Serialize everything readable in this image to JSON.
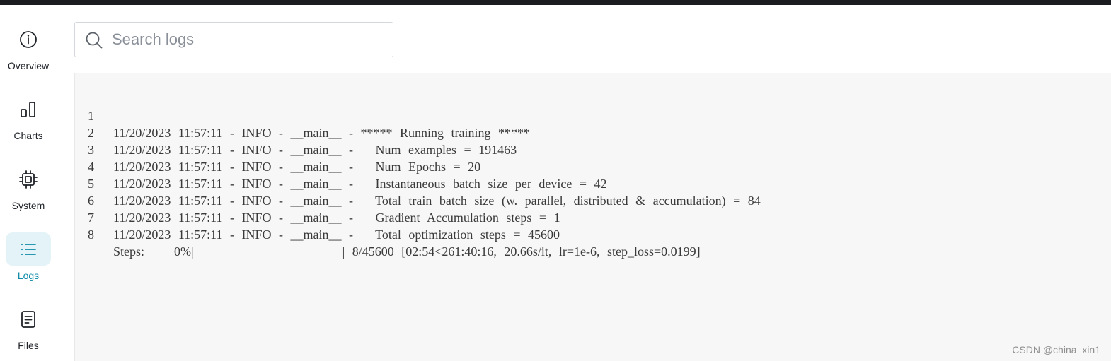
{
  "sidebar": {
    "items": [
      {
        "label": "Overview",
        "icon": "info-icon",
        "active": false
      },
      {
        "label": "Charts",
        "icon": "chart-icon",
        "active": false
      },
      {
        "label": "System",
        "icon": "chip-icon",
        "active": false
      },
      {
        "label": "Logs",
        "icon": "list-icon",
        "active": true
      },
      {
        "label": "Files",
        "icon": "file-icon",
        "active": false
      }
    ]
  },
  "search": {
    "placeholder": "Search logs",
    "value": ""
  },
  "logs": {
    "lines": [
      {
        "num": "1",
        "text": "11/20/2023 11:57:11 - INFO - __main__ - ***** Running training *****"
      },
      {
        "num": "2",
        "text": "11/20/2023 11:57:11 - INFO - __main__ -   Num examples = 191463"
      },
      {
        "num": "3",
        "text": "11/20/2023 11:57:11 - INFO - __main__ -   Num Epochs = 20"
      },
      {
        "num": "4",
        "text": "11/20/2023 11:57:11 - INFO - __main__ -   Instantaneous batch size per device = 42"
      },
      {
        "num": "5",
        "text": "11/20/2023 11:57:11 - INFO - __main__ -   Total train batch size (w. parallel, distributed & accumulation) = 84"
      },
      {
        "num": "6",
        "text": "11/20/2023 11:57:11 - INFO - __main__ -   Gradient Accumulation steps = 1"
      },
      {
        "num": "7",
        "text": "11/20/2023 11:57:11 - INFO - __main__ -   Total optimization steps = 45600"
      },
      {
        "num": "8",
        "text": "Steps:    0%|                    | 8/45600 [02:54<261:40:16, 20.66s/it, lr=1e-6, step_loss=0.0199]"
      }
    ]
  },
  "colors": {
    "accent": "#0d8aa8",
    "active_bg": "#e4f3f7",
    "log_bg": "#f7f7f7"
  },
  "watermark": "CSDN @china_xin1"
}
